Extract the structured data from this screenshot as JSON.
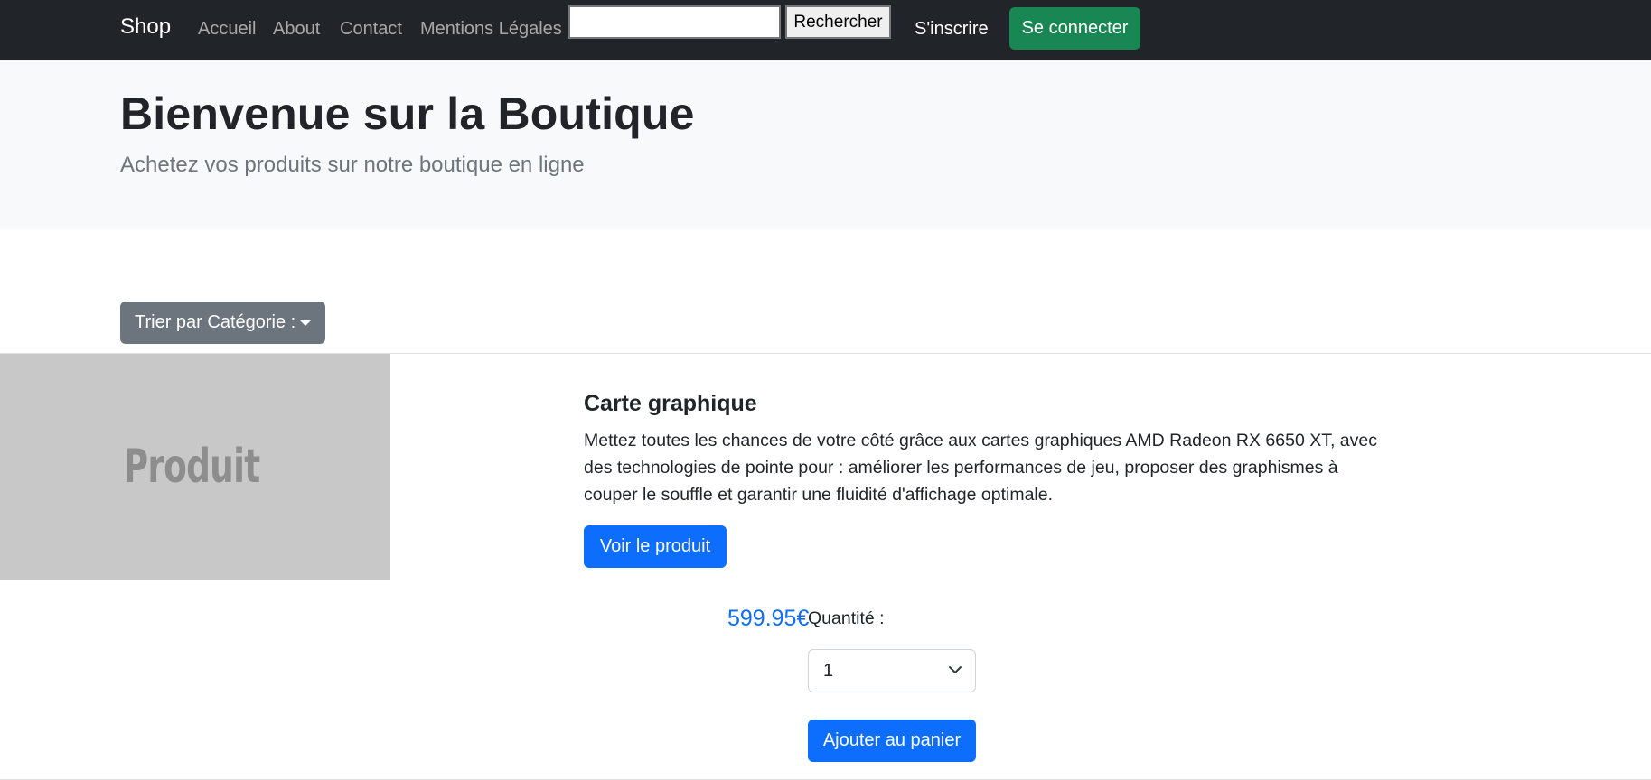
{
  "navbar": {
    "brand": "Shop",
    "links": [
      "Accueil",
      "About",
      "Contact",
      "Mentions Légales"
    ],
    "search": {
      "value": "",
      "button_label": "Rechercher"
    },
    "signup_label": "S'inscrire",
    "login_label": "Se connecter"
  },
  "hero": {
    "title": "Bienvenue sur la Boutique",
    "lead": "Achetez vos produits sur notre boutique en ligne"
  },
  "sort": {
    "label": "Trier par Catégorie :"
  },
  "product": {
    "image_text": "Produit",
    "title": "Carte graphique",
    "description": "Mettez toutes les chances de votre côté grâce aux cartes graphiques AMD Radeon RX 6650 XT, avec des technologies de pointe pour : améliorer les performances de jeu, proposer des graphismes à couper le souffle et garantir une fluidité d'affichage optimale.",
    "view_label": "Voir le produit",
    "price": "599.95€",
    "quantity_label": "Quantité :",
    "quantity_value": "1",
    "add_to_cart_label": "Ajouter au panier"
  },
  "colors": {
    "navbar_bg": "#212529",
    "hero_bg": "#f8f9fa",
    "primary": "#0d6efd",
    "success": "#198754",
    "secondary": "#6c757d",
    "image_placeholder": "#c8c8c8"
  },
  "icons": {
    "sort_caret": "caret-down-icon",
    "quantity_chevron": "chevron-down-icon"
  }
}
